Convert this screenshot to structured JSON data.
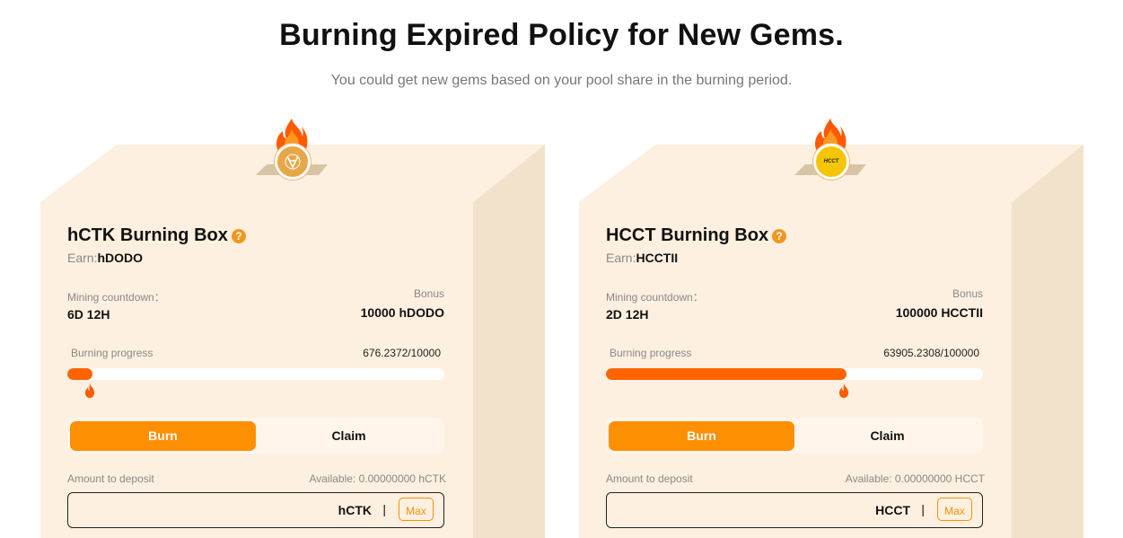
{
  "header": {
    "title": "Burning Expired Policy for New Gems.",
    "subtitle": "You could get new gems based on your pool share in the burning period."
  },
  "boxes": [
    {
      "title": "hCTK Burning Box",
      "earn_label": "Earn:",
      "earn_token": "hDODO",
      "countdown_label": "Mining countdown：",
      "countdown_value": "6D 12H",
      "bonus_label": "Bonus",
      "bonus_value": "10000 hDODO",
      "progress_label": "Burning progress",
      "progress_value": "676.2372/10000",
      "progress_fraction": 0.0676,
      "tabs": {
        "burn": "Burn",
        "claim": "Claim"
      },
      "deposit_label": "Amount to deposit",
      "available": "Available: 0.00000000 hCTK",
      "input_value": "",
      "token_symbol": "hCTK",
      "divider": "|",
      "max_label": "Max",
      "coin_icon": "dodo-bird-coin-icon",
      "coin_color": "#e8a64a"
    },
    {
      "title": "HCCT Burning Box",
      "earn_label": "Earn:",
      "earn_token": "HCCTII",
      "countdown_label": "Mining countdown：",
      "countdown_value": "2D 12H",
      "bonus_label": "Bonus",
      "bonus_value": "100000 HCCTII",
      "progress_label": "Burning progress",
      "progress_value": "63905.2308/100000",
      "progress_fraction": 0.639,
      "tabs": {
        "burn": "Burn",
        "claim": "Claim"
      },
      "deposit_label": "Amount to deposit",
      "available": "Available: 0.00000000 HCCT",
      "input_value": "",
      "token_symbol": "HCCT",
      "divider": "|",
      "max_label": "Max",
      "coin_icon": "hcct-coin-icon",
      "coin_text": "HCCT",
      "coin_color": "#f5c500"
    }
  ],
  "colors": {
    "accent": "#fd8f03",
    "progress": "#ff6400",
    "box_face": "#fdf0e0",
    "box_side": "#f2e2cb"
  }
}
